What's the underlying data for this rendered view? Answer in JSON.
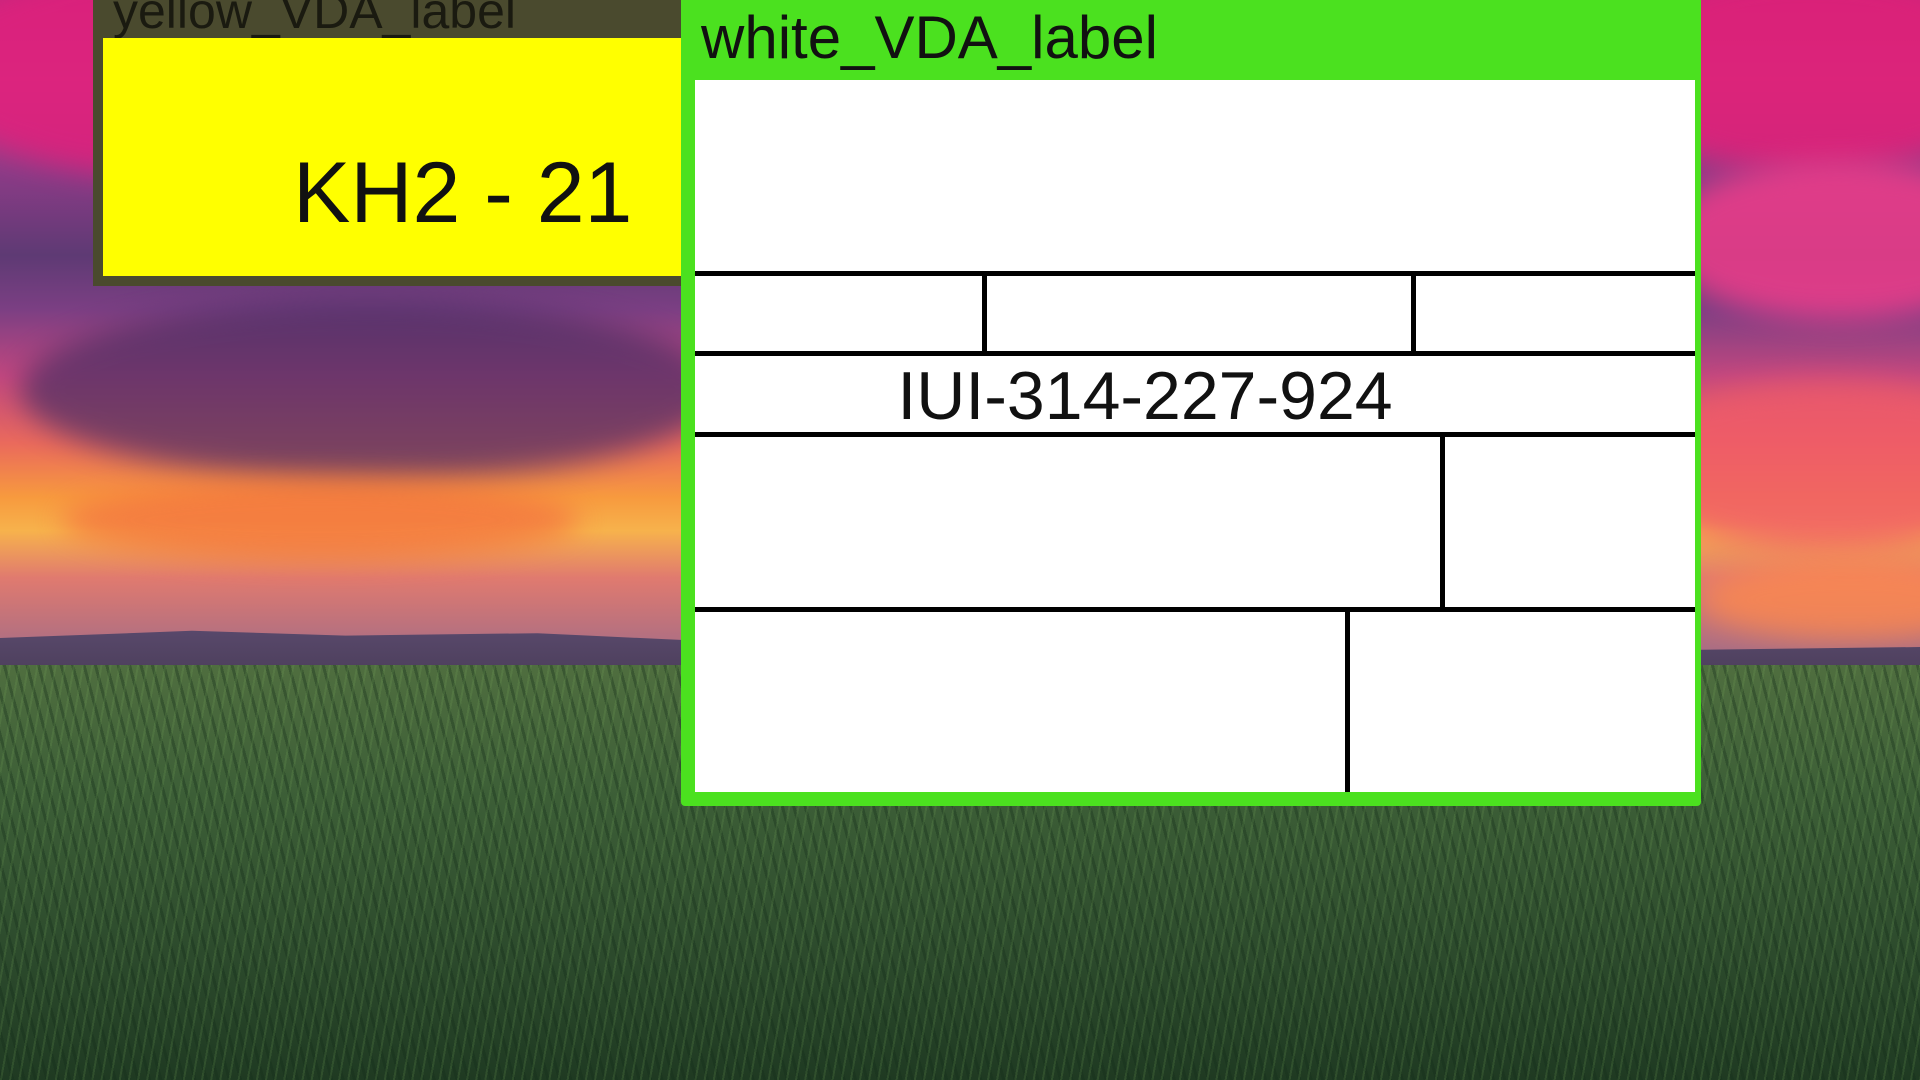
{
  "wallpaper": {
    "description_icon": "sunset-grass-field-wallpaper",
    "colors": {
      "sky_top": "#b72a7e",
      "sky_glow": "#f79a3e",
      "grass": "#2c4a2c"
    }
  },
  "yellow_window": {
    "title": "yellow_VDA_label",
    "code_text": "KH2 - 21",
    "body_color": "#ffff00",
    "frame_color": "#4a4a2e"
  },
  "white_window": {
    "title": "white_VDA_label",
    "frame_color": "#4be11f",
    "body_color": "#ffffff",
    "label_id": "IUI-314-227-924"
  }
}
